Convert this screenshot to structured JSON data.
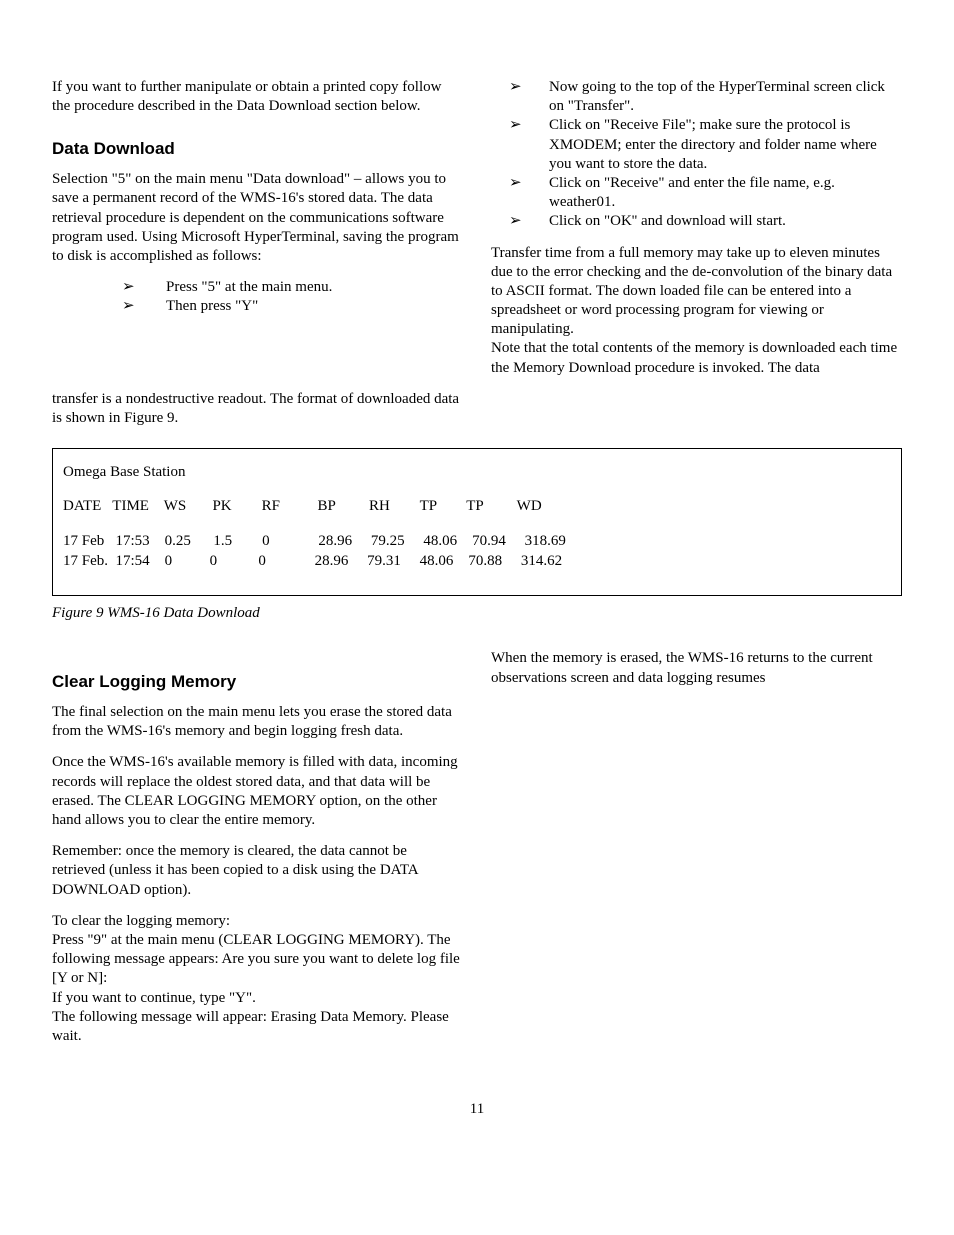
{
  "intro_para": "If you want to further manipulate or obtain a printed copy follow the procedure described in the Data Download section below.",
  "s1": {
    "heading": "Data Download",
    "para": "Selection \"5\" on the main menu \"Data download\" – allows you to save a permanent record of the WMS-16's stored data. The data retrieval procedure is dependent on the communications software program used. Using Microsoft HyperTerminal, saving the program to disk is accomplished as follows:",
    "bullets_left": {
      "b1": "Press \"5\" at the main menu.",
      "b2": "Then press \"Y\""
    },
    "bullets_right": {
      "b1": "Now going to the top of the HyperTerminal screen click on \"Transfer\".",
      "b2": "Click on \"Receive File\"; make sure the protocol is XMODEM; enter the directory and folder name where you want to store the data.",
      "b3": "Click on \"Receive\" and enter the file name, e.g. weather01.",
      "b4": "Click on \"OK'' and download will start."
    },
    "para_right1": "Transfer time from a full memory may take up to eleven minutes due to the error checking and the de-convolution of the binary data to ASCII format. The down loaded file can be entered into a spreadsheet or word processing program for viewing or manipulating.",
    "para_right2": "Note that the total contents of the memory is downloaded each time the Memory Download procedure is invoked. The data",
    "para_full": "transfer is a nondestructive readout. The format of downloaded data is shown in Figure 9."
  },
  "figure": {
    "title": "Omega Base Station",
    "header": "DATE   TIME    WS       PK        RF          BP         RH        TP        TP         WD",
    "row1": "17 Feb   17:53    0.25      1.5        0             28.96     79.25     48.06    70.94     318.69",
    "row2": "17 Feb.  17:54    0          0           0             28.96     79.31     48.06    70.88     314.62",
    "caption": "Figure 9 WMS-16 Data Download"
  },
  "s2": {
    "heading": "Clear Logging Memory",
    "p1": "The final selection on the main menu lets you erase the stored data from the WMS-16's memory and begin logging fresh data.",
    "p2": "Once the WMS-16's available memory is filled with data, incoming records will replace the oldest stored data, and that data will be erased. The CLEAR LOGGING MEMORY option, on the other hand allows you to clear the entire memory.",
    "p3": "Remember: once the memory is cleared, the data cannot be retrieved (unless it has been copied to a disk using the DATA DOWNLOAD option).",
    "p4a": "To clear the logging memory:",
    "p4b": "Press \"9\" at the main menu (CLEAR LOGGING MEMORY). The following message appears: Are you sure you want to delete log file [Y or N]:",
    "p4c": "If you want to continue, type \"Y\".",
    "p4d": "The following message will appear: Erasing Data Memory. Please wait.",
    "right": "When the memory is erased, the WMS-16 returns to the current observations screen and data logging resumes"
  },
  "page_number": "11",
  "glyph": "➢"
}
